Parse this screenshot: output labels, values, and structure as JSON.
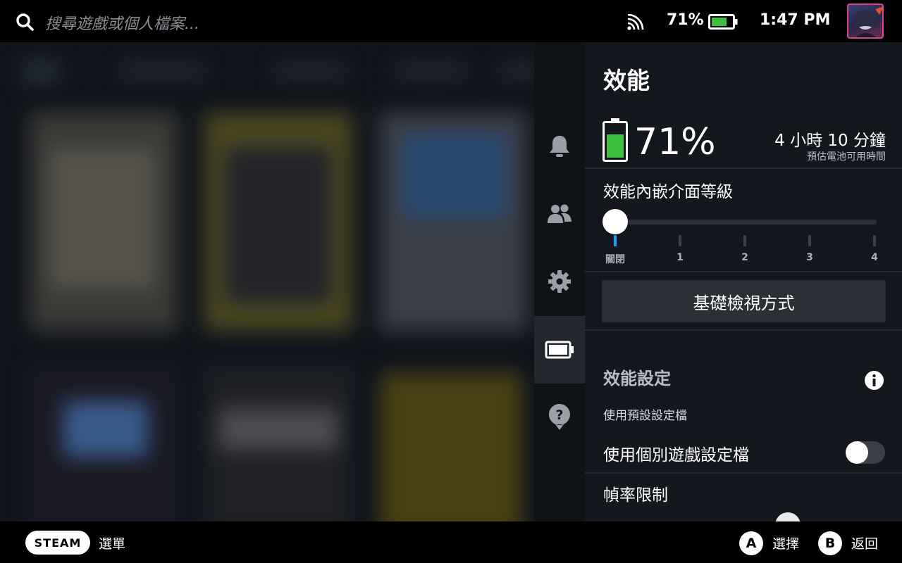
{
  "topbar": {
    "search_placeholder": "搜尋遊戲或個人檔案...",
    "battery_percent": "71%",
    "time": "1:47 PM"
  },
  "rail": {
    "items": [
      "bell-icon",
      "friends-icon",
      "gear-icon",
      "battery-icon",
      "help-icon"
    ],
    "active": "battery-icon"
  },
  "panel": {
    "title": "效能",
    "battery_percent": "71%",
    "battery_level": 0.71,
    "time_remaining": "4 小時 10 分鐘",
    "time_remaining_caption": "預估電池可用時間",
    "overlay_level_label": "效能內嵌介面等級",
    "overlay_levels": [
      "關閉",
      "1",
      "2",
      "3",
      "4"
    ],
    "overlay_selected": "關閉",
    "basic_view_button": "基礎檢視方式",
    "perf_settings_header": "效能設定",
    "default_profile_text": "使用預設設定檔",
    "per_game_profile_label": "使用個別遊戲設定檔",
    "per_game_profile_enabled": false,
    "frame_limit_label": "幀率限制"
  },
  "bottombar": {
    "steam_label": "STEAM",
    "menu_label": "選單",
    "a_button": "A",
    "a_label": "選擇",
    "b_button": "B",
    "b_label": "返回"
  },
  "colors": {
    "accent": "#1a9fff",
    "battery_green": "#3fbf3f",
    "panel_bg": "#14181e"
  }
}
